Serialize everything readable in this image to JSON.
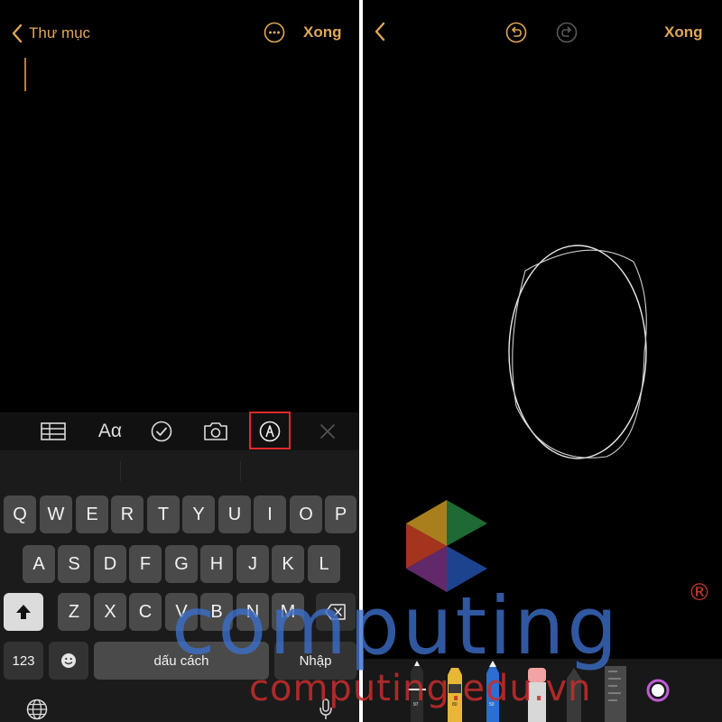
{
  "left_screen": {
    "back_label": "Thư mục",
    "done_label": "Xong",
    "toolbar": {
      "icons": [
        "table-icon",
        "checklist-icon",
        "camera-icon",
        "markup-icon",
        "close-icon"
      ],
      "format_label": "Aα"
    },
    "keyboard": {
      "row1": [
        "Q",
        "W",
        "E",
        "R",
        "T",
        "Y",
        "U",
        "I",
        "O",
        "P"
      ],
      "row2": [
        "A",
        "S",
        "D",
        "F",
        "G",
        "H",
        "J",
        "K",
        "L"
      ],
      "row3": [
        "Z",
        "X",
        "C",
        "V",
        "B",
        "N",
        "M"
      ],
      "numbers_label": "123",
      "space_label": "dấu cách",
      "return_label": "Nhập"
    }
  },
  "right_screen": {
    "done_label": "Xong",
    "tools": {
      "pen_label": "97",
      "marker_label": "80",
      "pencil_label": "50"
    },
    "icons": [
      "back-icon",
      "undo-icon",
      "redo-icon",
      "color-picker-icon"
    ]
  },
  "watermark": {
    "brand": "computing",
    "registered": "®",
    "url": "computing.edu.vn"
  },
  "colors": {
    "accent": "#e0a75a",
    "highlight": "#e02a2a",
    "watermark_blue": "#3c6ec8",
    "watermark_red": "#c82d2d"
  }
}
